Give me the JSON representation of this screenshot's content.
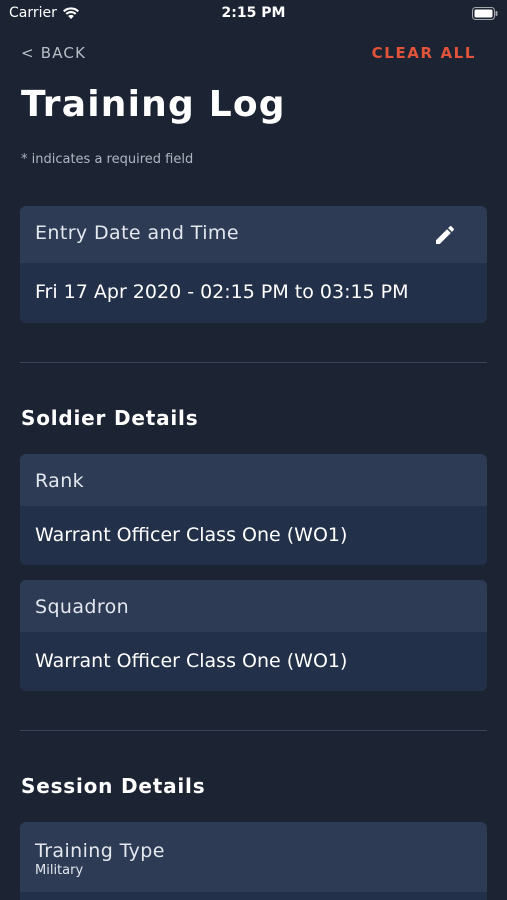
{
  "status_bar": {
    "carrier": "Carrier",
    "time": "2:15 PM"
  },
  "nav": {
    "back_label": "< BACK",
    "clear_label": "CLEAR ALL"
  },
  "page": {
    "title": "Training Log",
    "hint": "* indicates a required field"
  },
  "entry": {
    "label": "Entry Date and Time",
    "value": "Fri 17 Apr 2020 - 02:15 PM to 03:15 PM",
    "edit_icon": "pencil-icon"
  },
  "soldier": {
    "title": "Soldier Details",
    "rank": {
      "label": "Rank",
      "value": "Warrant Officer Class One (WO1)"
    },
    "squadron": {
      "label": "Squadron",
      "value": "Warrant Officer Class One (WO1)"
    }
  },
  "session": {
    "title": "Session Details",
    "training_type": {
      "label": "Training Type",
      "value": "Military"
    }
  },
  "colors": {
    "background": "#1c2433",
    "card_header": "#2d3b55",
    "card_body": "#233049",
    "accent": "#e2533a"
  }
}
